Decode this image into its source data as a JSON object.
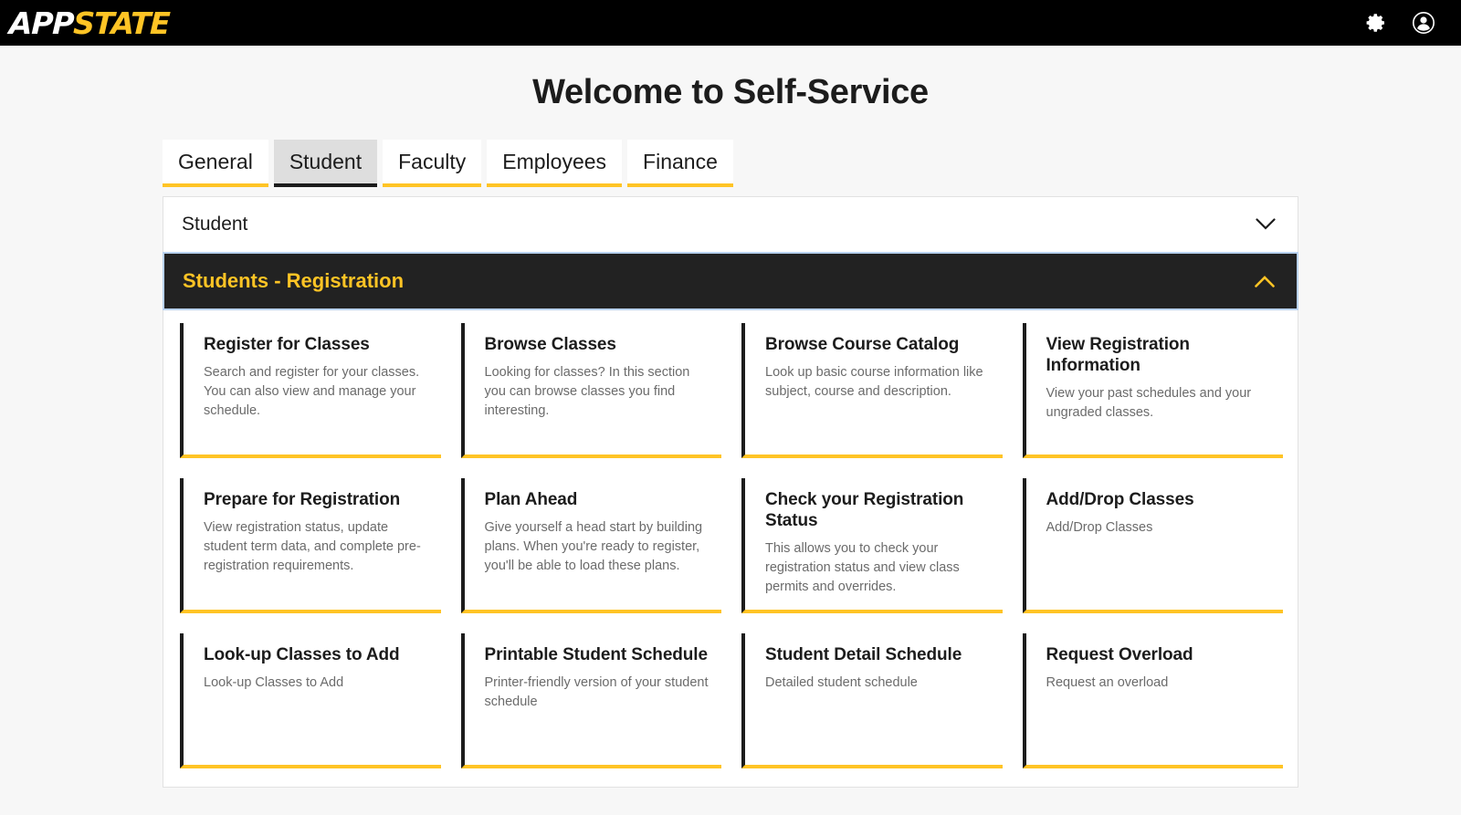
{
  "header": {
    "brand_first": "APP",
    "brand_second": "STATE",
    "settings_icon": "gear-icon",
    "account_icon": "user-avatar-icon"
  },
  "page": {
    "title": "Welcome to Self-Service"
  },
  "tabs": [
    {
      "label": "General",
      "active": false
    },
    {
      "label": "Student",
      "active": true
    },
    {
      "label": "Faculty",
      "active": false
    },
    {
      "label": "Employees",
      "active": false
    },
    {
      "label": "Finance",
      "active": false
    }
  ],
  "accordions": [
    {
      "label": "Student",
      "expanded": false,
      "chevron": "chevron-down-icon"
    },
    {
      "label": "Students - Registration",
      "expanded": true,
      "chevron": "chevron-up-icon"
    }
  ],
  "cards": [
    {
      "title": "Register for Classes",
      "desc": "Search and register for your classes. You can also view and manage your schedule."
    },
    {
      "title": "Browse Classes",
      "desc": "Looking for classes? In this section you can browse classes you find interesting."
    },
    {
      "title": "Browse Course Catalog",
      "desc": "Look up basic course information like subject, course and description."
    },
    {
      "title": "View Registration Information",
      "desc": "View your past schedules and your ungraded classes."
    },
    {
      "title": "Prepare for Registration",
      "desc": "View registration status, update student term data, and complete pre-registration requirements."
    },
    {
      "title": "Plan Ahead",
      "desc": "Give yourself a head start by building plans. When you're ready to register, you'll be able to load these plans."
    },
    {
      "title": "Check your Registration Status",
      "desc": "This allows you to check your registration status and view class permits and overrides."
    },
    {
      "title": "Add/Drop Classes",
      "desc": "Add/Drop Classes"
    },
    {
      "title": "Look-up Classes to Add",
      "desc": "Look-up Classes to Add"
    },
    {
      "title": "Printable Student Schedule",
      "desc": "Printer-friendly version of your student schedule"
    },
    {
      "title": "Student Detail Schedule",
      "desc": "Detailed student schedule"
    },
    {
      "title": "Request Overload",
      "desc": "Request an overload"
    }
  ],
  "colors": {
    "brand_yellow": "#ffc425",
    "brand_black": "#000000",
    "panel_dark": "#222222",
    "focus_blue": "#b9d2f0",
    "muted_text": "#6b6b6b"
  }
}
